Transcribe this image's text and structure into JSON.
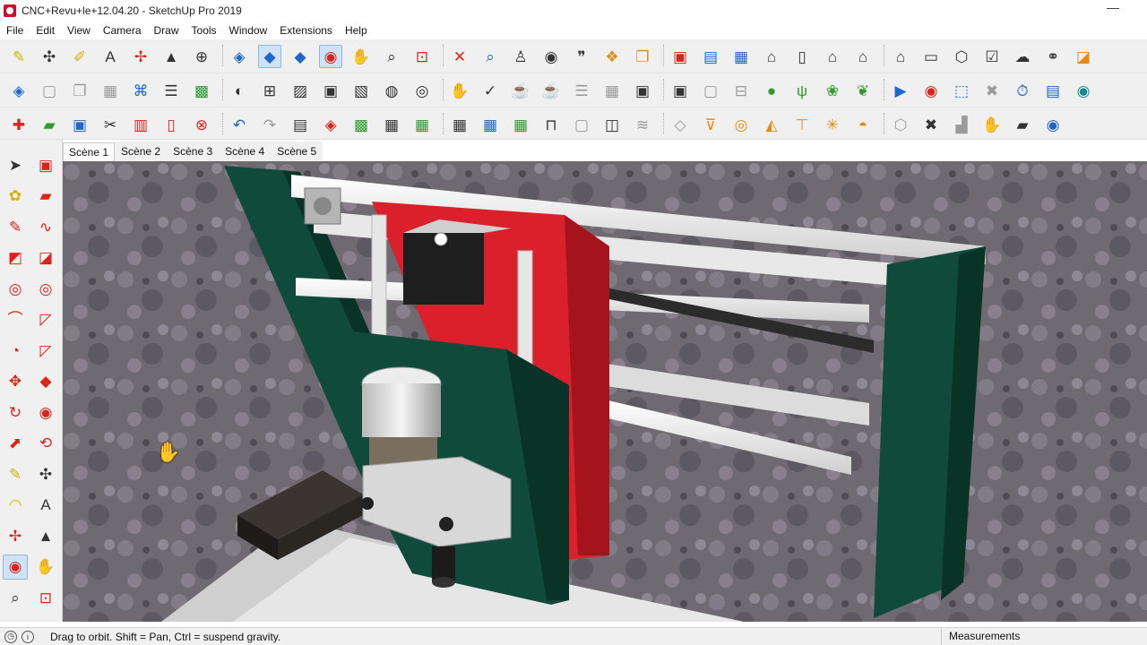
{
  "window": {
    "title": "CNC+Revu+le+12.04.20 - SketchUp Pro 2019",
    "minimize_glyph": "—"
  },
  "menu": [
    "File",
    "Edit",
    "View",
    "Camera",
    "Draw",
    "Tools",
    "Window",
    "Extensions",
    "Help"
  ],
  "scenes": [
    "Scène 1",
    "Scène 2",
    "Scène 3",
    "Scène 4",
    "Scène 5"
  ],
  "selected_scene": "Scène 1",
  "toolbars": {
    "row1": [
      {
        "name": "interact-icon",
        "glyph": "✎",
        "color": "c-yellow"
      },
      {
        "name": "dimension-icon",
        "glyph": "✣",
        "color": "c-dark"
      },
      {
        "name": "tape-measure-icon",
        "glyph": "✐",
        "color": "c-yellow"
      },
      {
        "name": "text-label-icon",
        "glyph": "A",
        "color": "c-dark"
      },
      {
        "name": "axes-icon",
        "glyph": "✢",
        "color": "c-red"
      },
      {
        "name": "3d-text-icon",
        "glyph": "▲",
        "color": "c-dark"
      },
      {
        "name": "move-view-icon",
        "glyph": "⊕",
        "color": "c-dark"
      },
      {
        "name": "iso-view-icon",
        "glyph": "◈",
        "color": "c-blue"
      },
      {
        "name": "top-view-icon",
        "glyph": "◆",
        "color": "c-blue",
        "active": true
      },
      {
        "name": "front-view-icon",
        "glyph": "◆",
        "color": "c-blue"
      },
      {
        "name": "orbit-icon",
        "glyph": "◉",
        "color": "c-red",
        "active": true
      },
      {
        "name": "pan-icon",
        "glyph": "✋",
        "color": "c-yellow"
      },
      {
        "name": "zoom-icon",
        "glyph": "⌕",
        "color": "c-dark"
      },
      {
        "name": "zoom-window-icon",
        "glyph": "⊡",
        "color": "c-red"
      },
      {
        "name": "zoom-extents-icon",
        "glyph": "✕",
        "color": "c-red"
      },
      {
        "name": "previous-view-icon",
        "glyph": "⌕",
        "color": "c-blue"
      },
      {
        "name": "position-camera-icon",
        "glyph": "♙",
        "color": "c-dark"
      },
      {
        "name": "look-around-icon",
        "glyph": "◉",
        "color": "c-dark"
      },
      {
        "name": "walk-icon",
        "glyph": "❞",
        "color": "c-dark"
      },
      {
        "name": "warehouse-icon",
        "glyph": "❖",
        "color": "c-orange"
      },
      {
        "name": "share-model-icon",
        "glyph": "❐",
        "color": "c-orange"
      },
      {
        "name": "extension-warehouse-icon",
        "glyph": "▣",
        "color": "c-red"
      },
      {
        "name": "layout-send-icon",
        "glyph": "▤",
        "color": "c-blue"
      },
      {
        "name": "outliner-icon",
        "glyph": "▦",
        "color": "c-blue"
      },
      {
        "name": "house-3d-icon",
        "glyph": "⌂",
        "color": "c-dark"
      },
      {
        "name": "door-icon",
        "glyph": "▯",
        "color": "c-dark"
      },
      {
        "name": "home-icon",
        "glyph": "⌂",
        "color": "c-dark"
      },
      {
        "name": "store-icon",
        "glyph": "⌂",
        "color": "c-dark"
      },
      {
        "name": "building-icon",
        "glyph": "⌂",
        "color": "c-dark"
      },
      {
        "name": "box-icon",
        "glyph": "▭",
        "color": "c-dark"
      },
      {
        "name": "component-icon",
        "glyph": "⬡",
        "color": "c-dark"
      },
      {
        "name": "checklist-icon",
        "glyph": "☑",
        "color": "c-dark"
      },
      {
        "name": "cloud-upload-icon",
        "glyph": "☁",
        "color": "c-dark"
      },
      {
        "name": "link-icon",
        "glyph": "⚭",
        "color": "c-dark"
      },
      {
        "name": "color-cube-icon",
        "glyph": "◪",
        "color": "c-orange"
      }
    ],
    "row2": [
      {
        "name": "section-plane-icon",
        "glyph": "◈",
        "color": "c-blue"
      },
      {
        "name": "blank-page-icon",
        "glyph": "▢",
        "color": "c-gray"
      },
      {
        "name": "copy-icon",
        "glyph": "❐",
        "color": "c-gray"
      },
      {
        "name": "clipboard-icon",
        "glyph": "▦",
        "color": "c-gray"
      },
      {
        "name": "tag-icon",
        "glyph": "⌘",
        "color": "c-blue"
      },
      {
        "name": "stack-icon",
        "glyph": "☰",
        "color": "c-dark"
      },
      {
        "name": "colors-icon",
        "glyph": "▩",
        "color": "c-green"
      },
      {
        "name": "rotate-view-icon",
        "glyph": "◐",
        "color": "c-dark"
      },
      {
        "name": "select-box-icon",
        "glyph": "⊞",
        "color": "c-dark"
      },
      {
        "name": "wireframe-icon",
        "glyph": "▨",
        "color": "c-dark"
      },
      {
        "name": "hidden-line-icon",
        "glyph": "▣",
        "color": "c-dark"
      },
      {
        "name": "shaded-icon",
        "glyph": "▧",
        "color": "c-dark"
      },
      {
        "name": "xray-icon",
        "glyph": "◍",
        "color": "c-dark"
      },
      {
        "name": "back-edges-icon",
        "glyph": "◎",
        "color": "c-dark"
      },
      {
        "name": "hand-select-icon",
        "glyph": "✋",
        "color": "c-gray"
      },
      {
        "name": "checkmark-icon",
        "glyph": "✓",
        "color": "c-dark"
      },
      {
        "name": "teapot-icon",
        "glyph": "☕",
        "color": "c-dark"
      },
      {
        "name": "teapot-hand-icon",
        "glyph": "☕",
        "color": "c-gray"
      },
      {
        "name": "stairs-icon",
        "glyph": "☰",
        "color": "c-gray"
      },
      {
        "name": "grid-icon",
        "glyph": "▦",
        "color": "c-gray"
      },
      {
        "name": "frame-icon",
        "glyph": "▣",
        "color": "c-dark"
      },
      {
        "name": "frame-2-icon",
        "glyph": "▣",
        "color": "c-dark"
      },
      {
        "name": "frame-3-icon",
        "glyph": "▢",
        "color": "c-gray"
      },
      {
        "name": "lock-icon",
        "glyph": "⊟",
        "color": "c-gray"
      },
      {
        "name": "tree-icon",
        "glyph": "●",
        "color": "c-green"
      },
      {
        "name": "grass-icon",
        "glyph": "ψ",
        "color": "c-green"
      },
      {
        "name": "plant-icon",
        "glyph": "❀",
        "color": "c-green"
      },
      {
        "name": "bush-icon",
        "glyph": "❦",
        "color": "c-green"
      },
      {
        "name": "play-icon",
        "glyph": "▶",
        "color": "c-blue"
      },
      {
        "name": "record-icon",
        "glyph": "◉",
        "color": "c-red"
      },
      {
        "name": "selection-frame-icon",
        "glyph": "⬚",
        "color": "c-blue"
      },
      {
        "name": "stop-icon",
        "glyph": "✖",
        "color": "c-gray"
      },
      {
        "name": "timer-icon",
        "glyph": "⏱",
        "color": "c-blue"
      },
      {
        "name": "film-icon",
        "glyph": "▤",
        "color": "c-blue"
      },
      {
        "name": "camera-icon",
        "glyph": "◉",
        "color": "c-teal"
      }
    ],
    "row3": [
      {
        "name": "new-file-icon",
        "glyph": "✚",
        "color": "c-red"
      },
      {
        "name": "open-file-icon",
        "glyph": "▰",
        "color": "c-green"
      },
      {
        "name": "save-icon",
        "glyph": "▣",
        "color": "c-blue"
      },
      {
        "name": "cut-icon",
        "glyph": "✂",
        "color": "c-dark"
      },
      {
        "name": "paste-icon",
        "glyph": "▥",
        "color": "c-red"
      },
      {
        "name": "copy-file-icon",
        "glyph": "▯",
        "color": "c-red"
      },
      {
        "name": "erase-icon",
        "glyph": "⊗",
        "color": "c-red"
      },
      {
        "name": "undo-icon",
        "glyph": "↶",
        "color": "c-blue"
      },
      {
        "name": "redo-icon",
        "glyph": "↷",
        "color": "c-gray"
      },
      {
        "name": "print-icon",
        "glyph": "▤",
        "color": "c-dark"
      },
      {
        "name": "model-info-icon",
        "glyph": "◈",
        "color": "c-red"
      },
      {
        "name": "make-component-icon",
        "glyph": "▩",
        "color": "c-green"
      },
      {
        "name": "components-icon",
        "glyph": "▦",
        "color": "c-dark"
      },
      {
        "name": "group-icon",
        "glyph": "▦",
        "color": "c-green"
      },
      {
        "name": "layers-icon",
        "glyph": "▦",
        "color": "c-dark"
      },
      {
        "name": "materials-icon",
        "glyph": "▦",
        "color": "c-blue"
      },
      {
        "name": "styles-icon",
        "glyph": "▦",
        "color": "c-green"
      },
      {
        "name": "table-icon",
        "glyph": "⊓",
        "color": "c-dark"
      },
      {
        "name": "box-outline-icon",
        "glyph": "▢",
        "color": "c-gray"
      },
      {
        "name": "box-3d-icon",
        "glyph": "◫",
        "color": "c-dark"
      },
      {
        "name": "sandbox-icon",
        "glyph": "≋",
        "color": "c-gray"
      },
      {
        "name": "drape-icon",
        "glyph": "◇",
        "color": "c-gray"
      },
      {
        "name": "solid-union-icon",
        "glyph": "⊽",
        "color": "c-orange"
      },
      {
        "name": "solid-subtract-icon",
        "glyph": "◎",
        "color": "c-orange"
      },
      {
        "name": "solid-intersect-icon",
        "glyph": "◭",
        "color": "c-orange"
      },
      {
        "name": "solid-trim-icon",
        "glyph": "⊤",
        "color": "c-orange"
      },
      {
        "name": "solid-split-icon",
        "glyph": "✳",
        "color": "c-orange"
      },
      {
        "name": "solid-shell-icon",
        "glyph": "◓",
        "color": "c-orange"
      },
      {
        "name": "solid-outer-icon",
        "glyph": "⬡",
        "color": "c-gray"
      },
      {
        "name": "tools-icon",
        "glyph": "✖",
        "color": "c-dark"
      },
      {
        "name": "stairs-2-icon",
        "glyph": "▟",
        "color": "c-gray"
      },
      {
        "name": "hand-gesture-icon",
        "glyph": "✋",
        "color": "c-blue"
      },
      {
        "name": "flag-icon",
        "glyph": "▰",
        "color": "c-dark"
      },
      {
        "name": "geo-location-icon",
        "glyph": "◉",
        "color": "c-blue"
      }
    ]
  },
  "left_tools": [
    {
      "name": "select-tool-icon",
      "glyph": "➤",
      "color": "c-dark"
    },
    {
      "name": "make-component-tool-icon",
      "glyph": "▣",
      "color": "c-red"
    },
    {
      "name": "paint-bucket-icon",
      "glyph": "✿",
      "color": "c-yellow"
    },
    {
      "name": "eraser-icon",
      "glyph": "▰",
      "color": "c-red"
    },
    {
      "name": "line-tool-icon",
      "glyph": "✎",
      "color": "c-red"
    },
    {
      "name": "freehand-icon",
      "glyph": "∿",
      "color": "c-red"
    },
    {
      "name": "rectangle-tool-icon",
      "glyph": "◩",
      "color": "c-red"
    },
    {
      "name": "rotated-rectangle-icon",
      "glyph": "◪",
      "color": "c-red"
    },
    {
      "name": "circle-tool-icon",
      "glyph": "◎",
      "color": "c-red"
    },
    {
      "name": "polygon-tool-icon",
      "glyph": "◎",
      "color": "c-red"
    },
    {
      "name": "arc-tool-icon",
      "glyph": "⌒",
      "color": "c-red"
    },
    {
      "name": "two-point-arc-icon",
      "glyph": "◸",
      "color": "c-red"
    },
    {
      "name": "three-point-arc-icon",
      "glyph": "◔",
      "color": "c-red"
    },
    {
      "name": "pie-tool-icon",
      "glyph": "◸",
      "color": "c-red"
    },
    {
      "name": "move-tool-icon",
      "glyph": "✥",
      "color": "c-red"
    },
    {
      "name": "push-pull-icon",
      "glyph": "◆",
      "color": "c-red"
    },
    {
      "name": "rotate-tool-icon",
      "glyph": "↻",
      "color": "c-red"
    },
    {
      "name": "follow-me-icon",
      "glyph": "◉",
      "color": "c-red"
    },
    {
      "name": "scale-tool-icon",
      "glyph": "⬈",
      "color": "c-red"
    },
    {
      "name": "offset-tool-icon",
      "glyph": "⟲",
      "color": "c-red"
    },
    {
      "name": "tape-tool-icon",
      "glyph": "✎",
      "color": "c-yellow"
    },
    {
      "name": "dimension-tool-icon",
      "glyph": "✣",
      "color": "c-dark"
    },
    {
      "name": "protractor-icon",
      "glyph": "◠",
      "color": "c-yellow"
    },
    {
      "name": "text-tool-icon",
      "glyph": "A",
      "color": "c-dark"
    },
    {
      "name": "axes-tool-icon",
      "glyph": "✢",
      "color": "c-red"
    },
    {
      "name": "3d-text-tool-icon",
      "glyph": "▲",
      "color": "c-dark"
    },
    {
      "name": "orbit-tool-icon",
      "glyph": "◉",
      "color": "c-red",
      "active": true
    },
    {
      "name": "pan-tool-icon",
      "glyph": "✋",
      "color": "c-yellow"
    },
    {
      "name": "zoom-tool-icon",
      "glyph": "⌕",
      "color": "c-dark"
    },
    {
      "name": "zoom-window-tool-icon",
      "glyph": "⊡",
      "color": "c-red"
    }
  ],
  "status": {
    "hint": "Drag to orbit. Shift = Pan, Ctrl = suspend gravity.",
    "measurements_label": "Measurements",
    "measurements_value": ""
  },
  "colors": {
    "frame_dark_green": "#0f4a3a",
    "carriage_red": "#d9202b",
    "rail_white": "#f2f2f2",
    "terrain": "#6f6a72",
    "selection_blue": "#cfe3f7"
  }
}
